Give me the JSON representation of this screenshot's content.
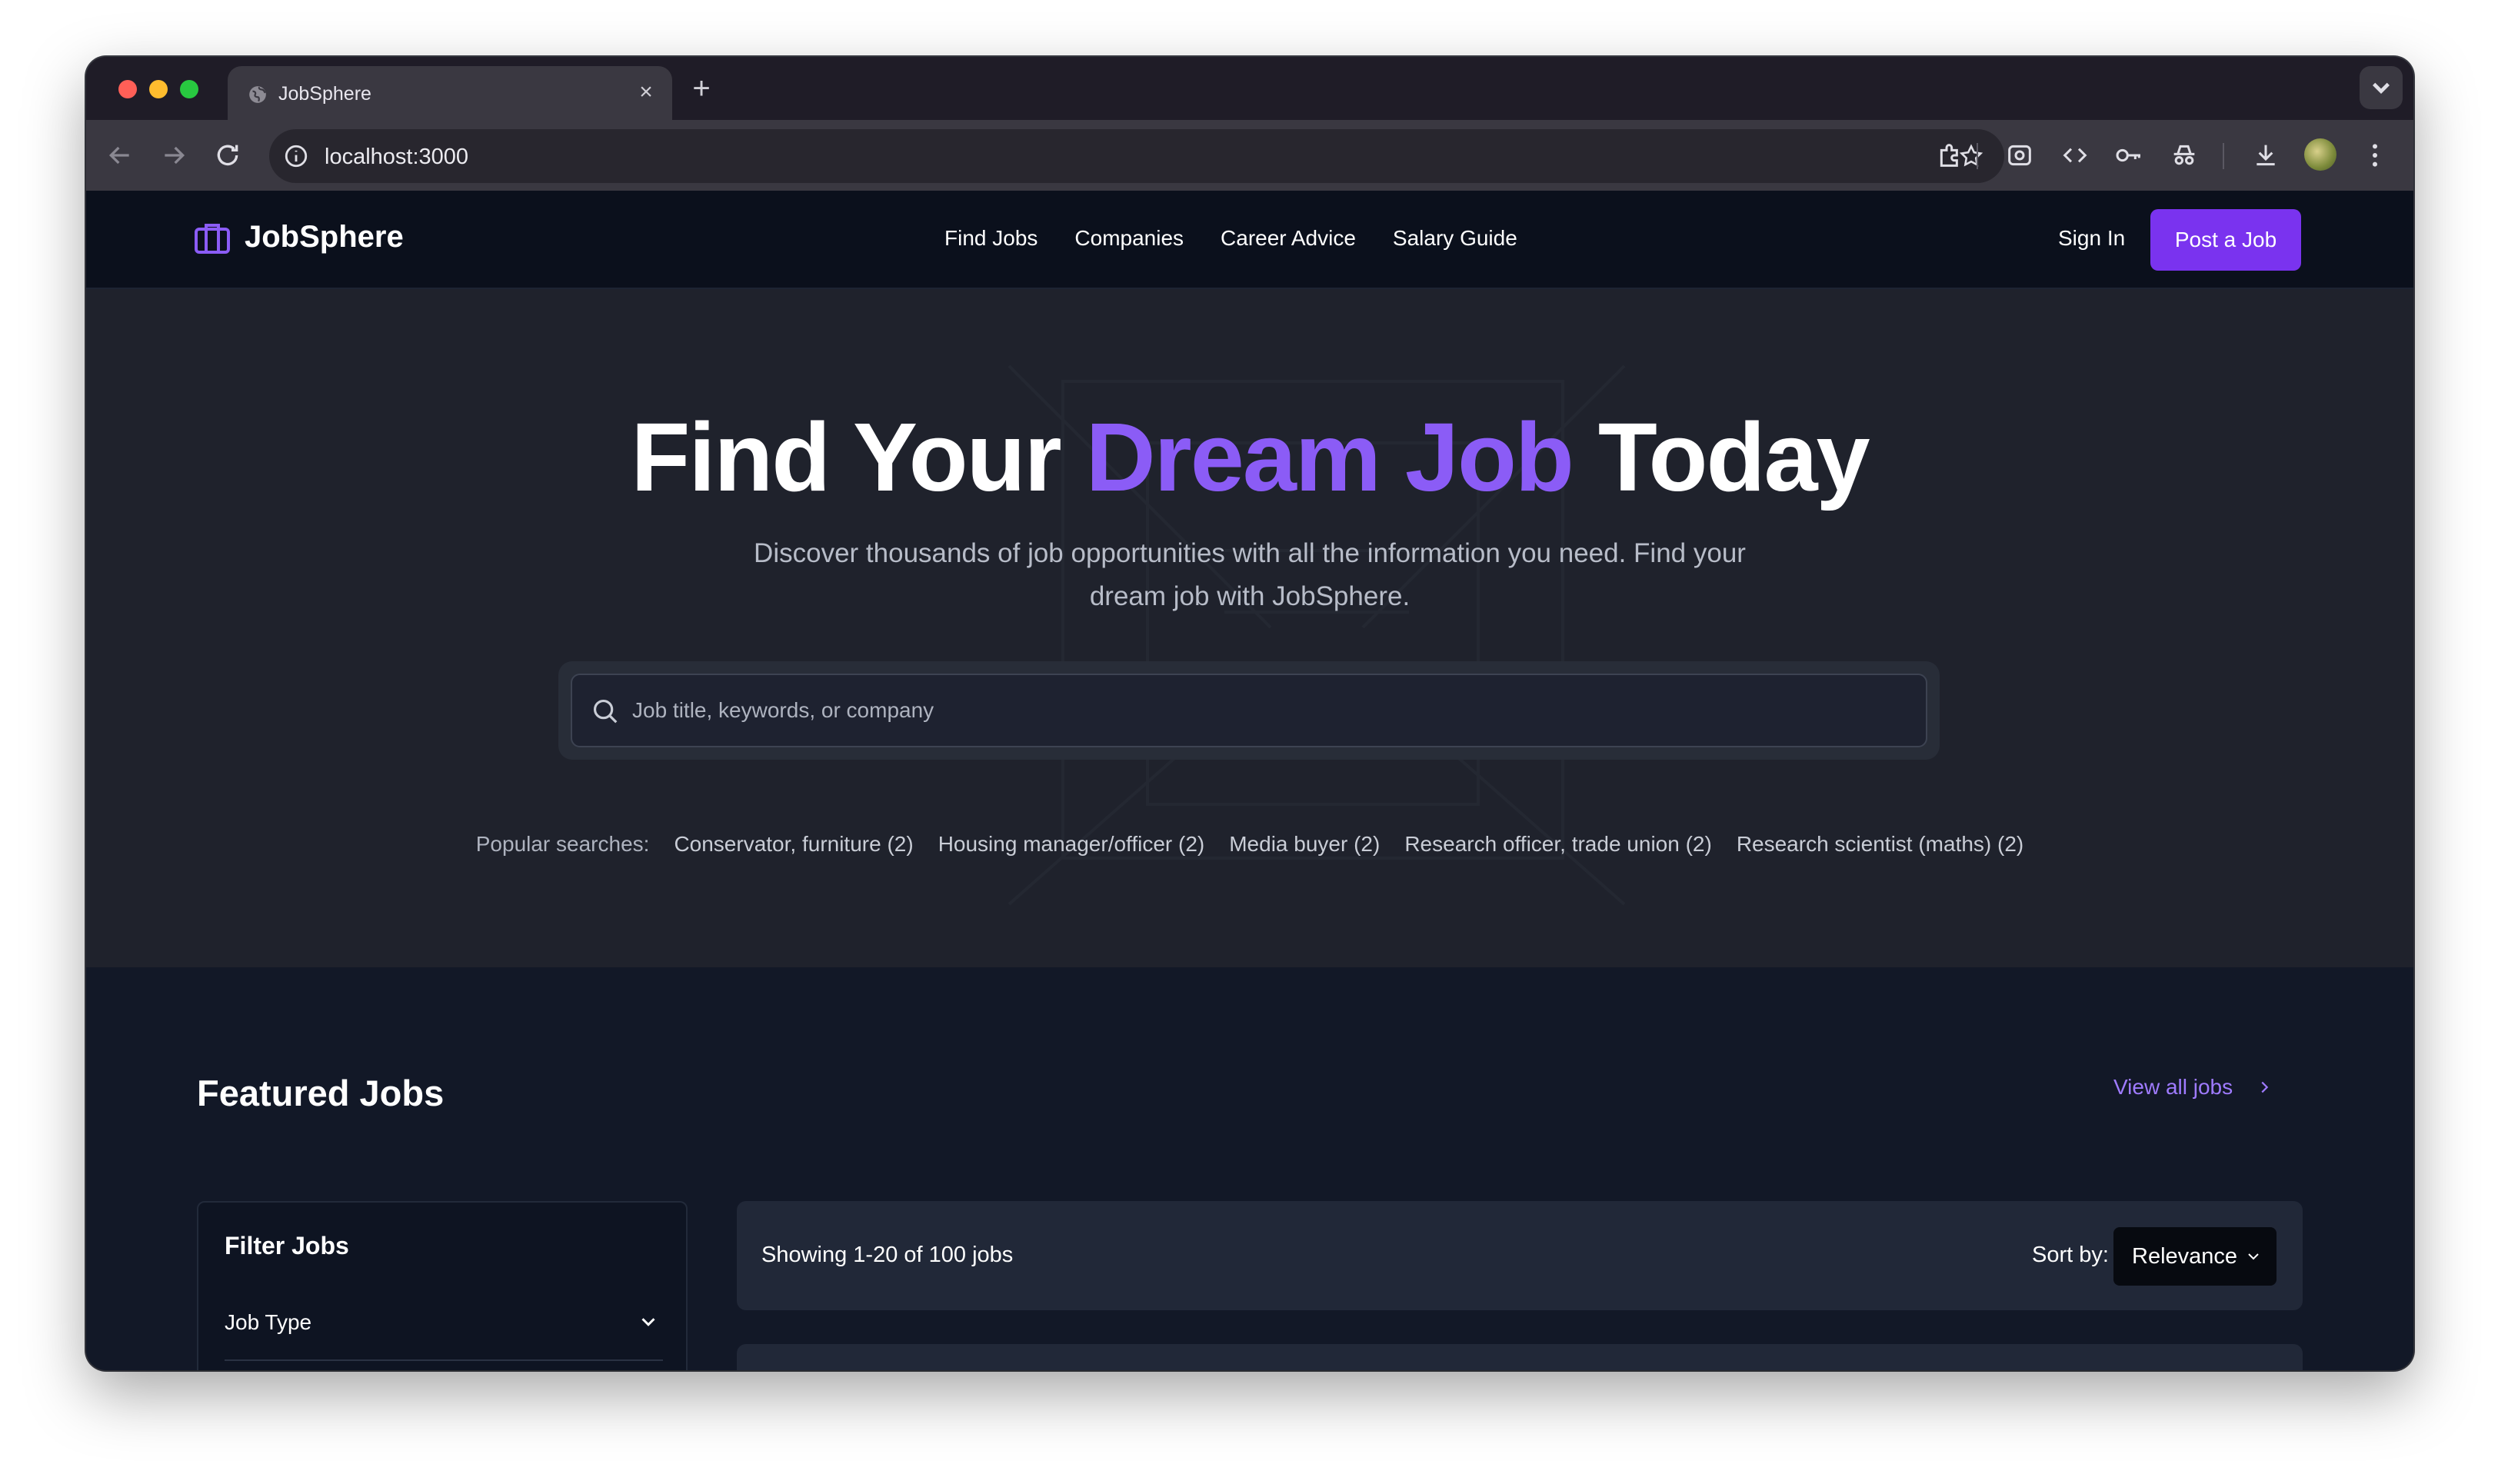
{
  "browser": {
    "tab_title": "JobSphere",
    "url": "localhost:3000"
  },
  "nav": {
    "brand": "JobSphere",
    "links": [
      "Find Jobs",
      "Companies",
      "Career Advice",
      "Salary Guide"
    ],
    "sign_in": "Sign In",
    "post_job": "Post a Job"
  },
  "hero": {
    "title_part1": "Find Your",
    "title_accent": "Dream Job",
    "title_part2": "Today",
    "subtitle": "Discover thousands of job opportunities with all the information you need. Find your dream job with JobSphere.",
    "search_placeholder": "Job title, keywords, or company",
    "popular_label": "Popular searches:",
    "popular_tags": [
      "Conservator, furniture (2)",
      "Housing manager/officer (2)",
      "Media buyer (2)",
      "Research officer, trade union (2)",
      "Research scientist (maths) (2)"
    ]
  },
  "featured": {
    "title": "Featured Jobs",
    "view_all": "View all jobs",
    "filter_title": "Filter Jobs",
    "filter_job_type": "Job Type",
    "showing": "Showing 1-20 of 100 jobs",
    "sort_label": "Sort by:",
    "sort_value": "Relevance"
  },
  "colors": {
    "accent": "#8b5cf6",
    "button": "#7a33ef",
    "link": "#9f7bff"
  }
}
